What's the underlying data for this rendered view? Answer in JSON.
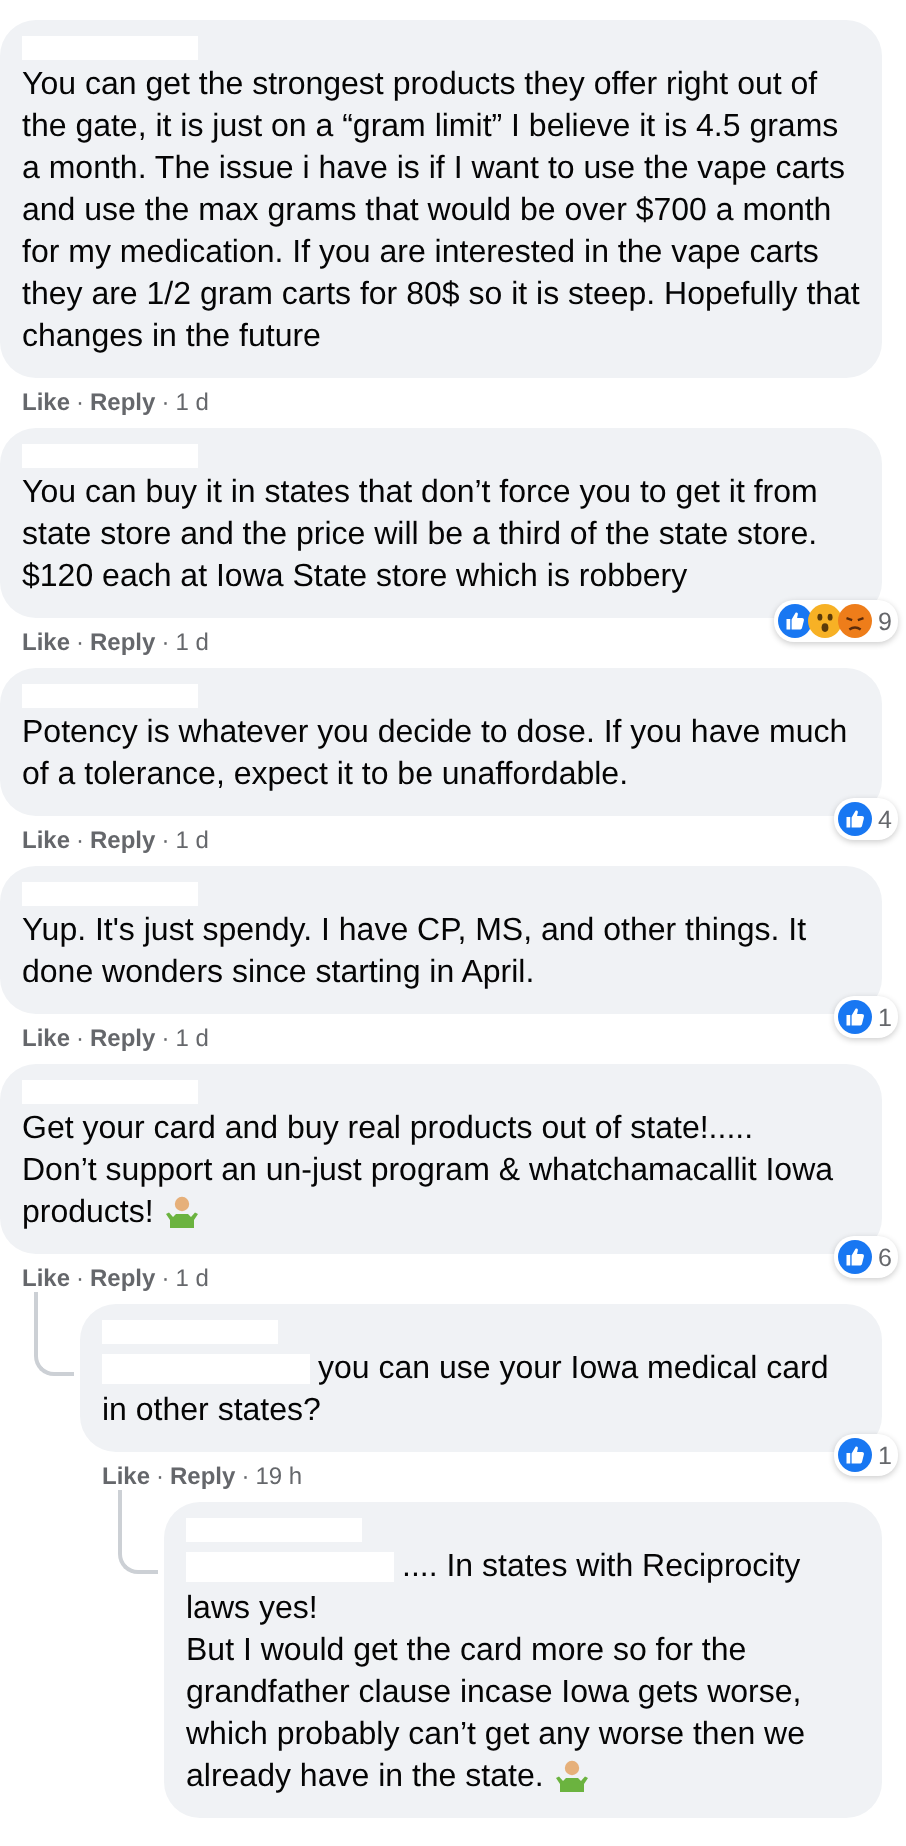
{
  "comments": [
    {
      "name_hidden": true,
      "text": "You can get the strongest products they offer right out of the gate, it is just on a “gram limit” I believe it is 4.5 grams a month. The issue i have is if I want to use the vape carts and use the max grams that would be over $700 a month for my medication. If you are interested in the vape carts they are 1/2 gram carts for 80$ so it is steep. Hopefully that changes in the future",
      "actions": [
        {
          "kind": "link",
          "text": "Like"
        },
        {
          "kind": "sep",
          "text": "·"
        },
        {
          "kind": "link",
          "text": "Reply"
        },
        {
          "kind": "sep",
          "text": "·"
        },
        {
          "kind": "time",
          "text": "1 d"
        }
      ]
    },
    {
      "name_hidden": true,
      "text": "You can buy it in states that don’t force you to get it from state store and the price will be a third of the state store. $120 each at Iowa State store which is robbery",
      "actions": [
        {
          "kind": "link",
          "text": "Like"
        },
        {
          "kind": "sep",
          "text": "·"
        },
        {
          "kind": "link",
          "text": "Reply"
        },
        {
          "kind": "sep",
          "text": "·"
        },
        {
          "kind": "time",
          "text": "1 d"
        }
      ],
      "reactions": {
        "icons": [
          {
            "kind": "like"
          },
          {
            "kind": "wow"
          },
          {
            "kind": "angry"
          }
        ],
        "count": "9"
      }
    },
    {
      "name_hidden": true,
      "text": "Potency is whatever you decide to dose. If you have much of a tolerance, expect it to be unaffordable.",
      "actions": [
        {
          "kind": "link",
          "text": "Like"
        },
        {
          "kind": "sep",
          "text": "·"
        },
        {
          "kind": "link",
          "text": "Reply"
        },
        {
          "kind": "sep",
          "text": "·"
        },
        {
          "kind": "time",
          "text": "1 d"
        }
      ],
      "reactions": {
        "icons": [
          {
            "kind": "like"
          }
        ],
        "count": "4"
      }
    },
    {
      "name_hidden": true,
      "text": "Yup. It's just spendy. I have CP, MS, and other things. It done wonders since starting in April.",
      "actions": [
        {
          "kind": "link",
          "text": "Like"
        },
        {
          "kind": "sep",
          "text": "·"
        },
        {
          "kind": "link",
          "text": "Reply"
        },
        {
          "kind": "sep",
          "text": "·"
        },
        {
          "kind": "time",
          "text": "1 d"
        }
      ],
      "reactions": {
        "icons": [
          {
            "kind": "like"
          }
        ],
        "count": "1"
      }
    },
    {
      "name_hidden": true,
      "text": "Get your card and buy real products out of state!.....\nDon’t support an un-just program & whatchamacallit Iowa products!",
      "emoji": {
        "kind": "shrug"
      },
      "actions": [
        {
          "kind": "link",
          "text": "Like"
        },
        {
          "kind": "sep",
          "text": "·"
        },
        {
          "kind": "link",
          "text": "Reply"
        },
        {
          "kind": "sep",
          "text": "·"
        },
        {
          "kind": "time",
          "text": "1 d"
        }
      ],
      "reactions": {
        "icons": [
          {
            "kind": "like"
          }
        ],
        "count": "6"
      },
      "children": [
        {
          "name_hidden": true,
          "mention_hidden": true,
          "first_line": "you can use your Iowa medical card",
          "text": "in other states?",
          "actions": [
            {
              "kind": "link",
              "text": "Like"
            },
            {
              "kind": "sep",
              "text": "·"
            },
            {
              "kind": "link",
              "text": "Reply"
            },
            {
              "kind": "sep",
              "text": "·"
            },
            {
              "kind": "time",
              "text": "19 h"
            }
          ],
          "reactions": {
            "icons": [
              {
                "kind": "like"
              }
            ],
            "count": "1"
          },
          "children": [
            {
              "name_hidden": true,
              "mention_hidden": true,
              "first_line": ".... In states with Reciprocity",
              "text": "laws yes!\nBut I would get the card more so for the grandfather clause incase Iowa gets worse, which probably can’t get any worse then we already have in the state.",
              "emoji": {
                "kind": "shrug"
              }
            }
          ]
        }
      ]
    }
  ]
}
